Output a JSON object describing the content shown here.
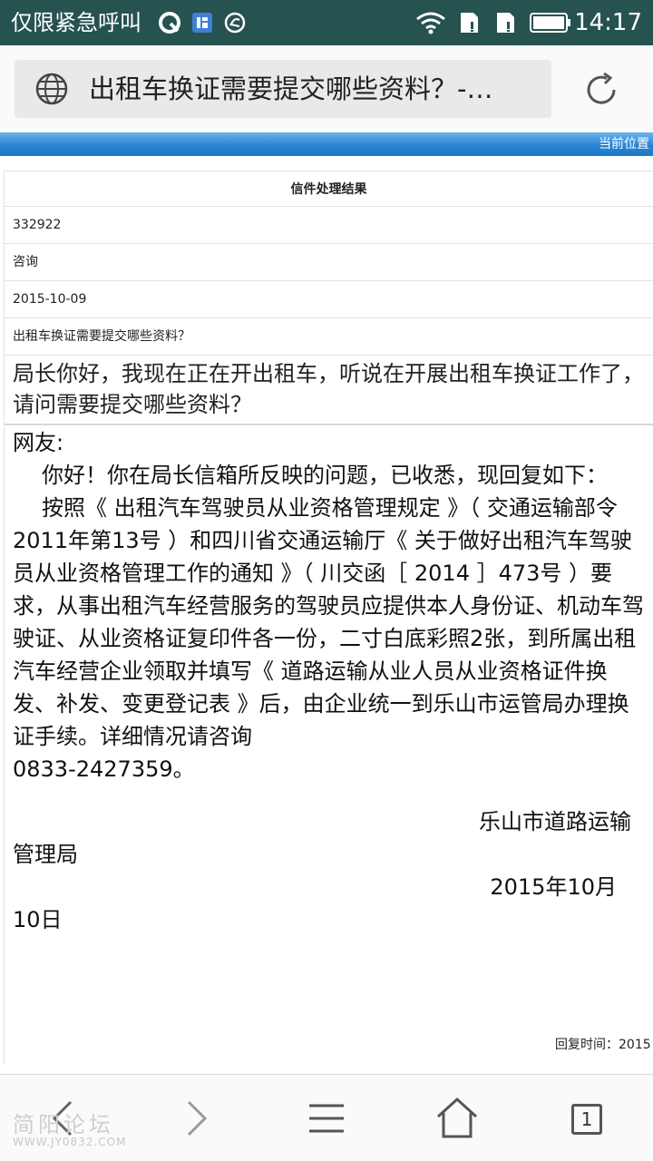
{
  "status_bar": {
    "carrier": "仅限紧急呼叫",
    "time": "14:17",
    "icons": [
      "notification-q-icon",
      "notification-app-icon",
      "notification-sync-icon",
      "wifi-icon",
      "sim1-icon",
      "sim2-icon",
      "battery-icon"
    ]
  },
  "browser": {
    "page_title": "出租车换证需要提交哪些资料？-…",
    "current_location_label": "当前位置"
  },
  "letter": {
    "header": "信件处理结果",
    "number": "332922",
    "type": "咨询",
    "date": "2015-10-09",
    "subject": "出租车换证需要提交哪些资料？",
    "question": "局长你好，我现在正在开出租车，听说在开展出租车换证工作了，请问需要提交哪些资料？"
  },
  "reply": {
    "salutation": "网友:",
    "para1": "你好！你在局长信箱所反映的问题，已收悉，现回复如下：",
    "para2": "按照《 出租汽车驾驶员从业资格管理规定 》（ 交通运输部令2011年第13号 ）和四川省交通运输厅《 关于做好出租汽车驾驶员从业资格管理工作的通知 》（ 川交函［ 2014 ］473号 ）要求，从事出租汽车经营服务的驾驶员应提供本人身份证、机动车驾驶证、从业资格证复印件各一份，二寸白底彩照2张，到所属出租汽车经营企业领取并填写《 道路运输从业人员从业资格证件换发、补发、变更登记表 》后，由企业统一到乐山市运管局办理换证手续。详细情况请咨询",
    "phone": "0833-2427359。",
    "signature_org_line1": "乐山市道路运输",
    "signature_org_line2": "管理局",
    "signature_date_line1": "2015年10月",
    "signature_date_line2": "10日",
    "reply_time": "回复时间：2015"
  },
  "nav": {
    "tab_count": "1",
    "watermark": "简阳论坛",
    "watermark_url": "WWW.JY0832.COM"
  }
}
